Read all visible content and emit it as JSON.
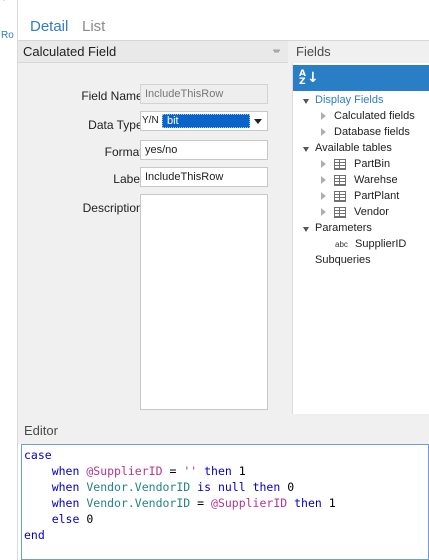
{
  "left_strip": {
    "text": "Ro"
  },
  "tabs": [
    {
      "label": "Detail",
      "active": true
    },
    {
      "label": "List",
      "active": false
    }
  ],
  "calculated_field": {
    "title": "Calculated Field",
    "field_name_label": "Field Name:",
    "field_name_value": "IncludeThisRow",
    "data_type_label": "Data Type:",
    "data_type_prefix": "Y/N",
    "data_type_value": "bit",
    "format_label": "Format:",
    "format_value": "yes/no",
    "label_label": "Label:",
    "label_value": "IncludeThisRow",
    "description_label": "Description:",
    "description_value": ""
  },
  "fields": {
    "title": "Fields",
    "display_fields": "Display Fields",
    "calculated_fields": "Calculated fields",
    "database_fields": "Database fields",
    "available_tables": "Available tables",
    "tables": [
      "PartBin",
      "Warehse",
      "PartPlant",
      "Vendor"
    ],
    "parameters": "Parameters",
    "parameter_type": "abc",
    "parameter_items": [
      "SupplierID"
    ],
    "subqueries": "Subqueries"
  },
  "editor": {
    "title": "Editor",
    "code": {
      "case": "case",
      "when": "when",
      "then": "then",
      "is": "is",
      "null": "null",
      "else": "else",
      "end": "end",
      "param": "@SupplierID",
      "vendor_ref": "Vendor.VendorID",
      "eq": "=",
      "empty_str": "''",
      "one": "1",
      "zero": "0"
    }
  },
  "colors": {
    "accent": "#2f7dc4",
    "selection": "#0a63c9",
    "keyword": "#0000cc",
    "parameter": "#b6348c",
    "field_ref": "#22838a"
  }
}
